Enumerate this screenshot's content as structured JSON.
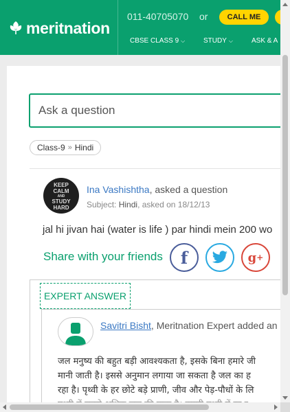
{
  "header": {
    "logo_text": "meritnation",
    "phone": "011-40705070",
    "or_text": "or",
    "call_label": "CALL ME",
    "nav": [
      {
        "label": "CBSE CLASS 9"
      },
      {
        "label": "STUDY"
      },
      {
        "label": "ASK & A"
      }
    ],
    "brand_color": "#0aa06e",
    "call_color": "#ffd400"
  },
  "search": {
    "placeholder": "Ask a question"
  },
  "breadcrumb": {
    "class": "Class-9",
    "separator": "»",
    "subject": "Hindi"
  },
  "question": {
    "avatar_lines": [
      "KEEP",
      "CALM",
      "AND",
      "STUDY",
      "HARD"
    ],
    "asker_name": "Ina Vashishtha",
    "asker_suffix": ", asked a question",
    "subject_prefix": "Subject:",
    "subject": "Hindi",
    "asked_on": ", asked on 18/12/13",
    "text": "jal hi jivan hai (water is life ) par hindi mein 200 wo"
  },
  "share": {
    "label": "Share with your friends",
    "icons": [
      "facebook-icon",
      "twitter-icon",
      "google-plus-icon"
    ]
  },
  "answer": {
    "tag": "EXPERT ANSWER",
    "expert_name": "Savitri Bisht",
    "expert_suffix": ", Meritnation Expert added an a",
    "lines": [
      "जल मनुष्य की बहुत बड़ी आवश्यकता है, इसके बिना हमारे जी",
      "मानी जाती है। इससे अनुमान लगाया जा सकता है जल का ह",
      "रहा है। पृथ्वी के हर छोटे बड़े प्राणी, जीव और पेड़-पौधों के लि",
      "पृथ्वी में सबसे अधिक जल की मात्रा है। हमारी पृथ्वी में रह र"
    ]
  }
}
